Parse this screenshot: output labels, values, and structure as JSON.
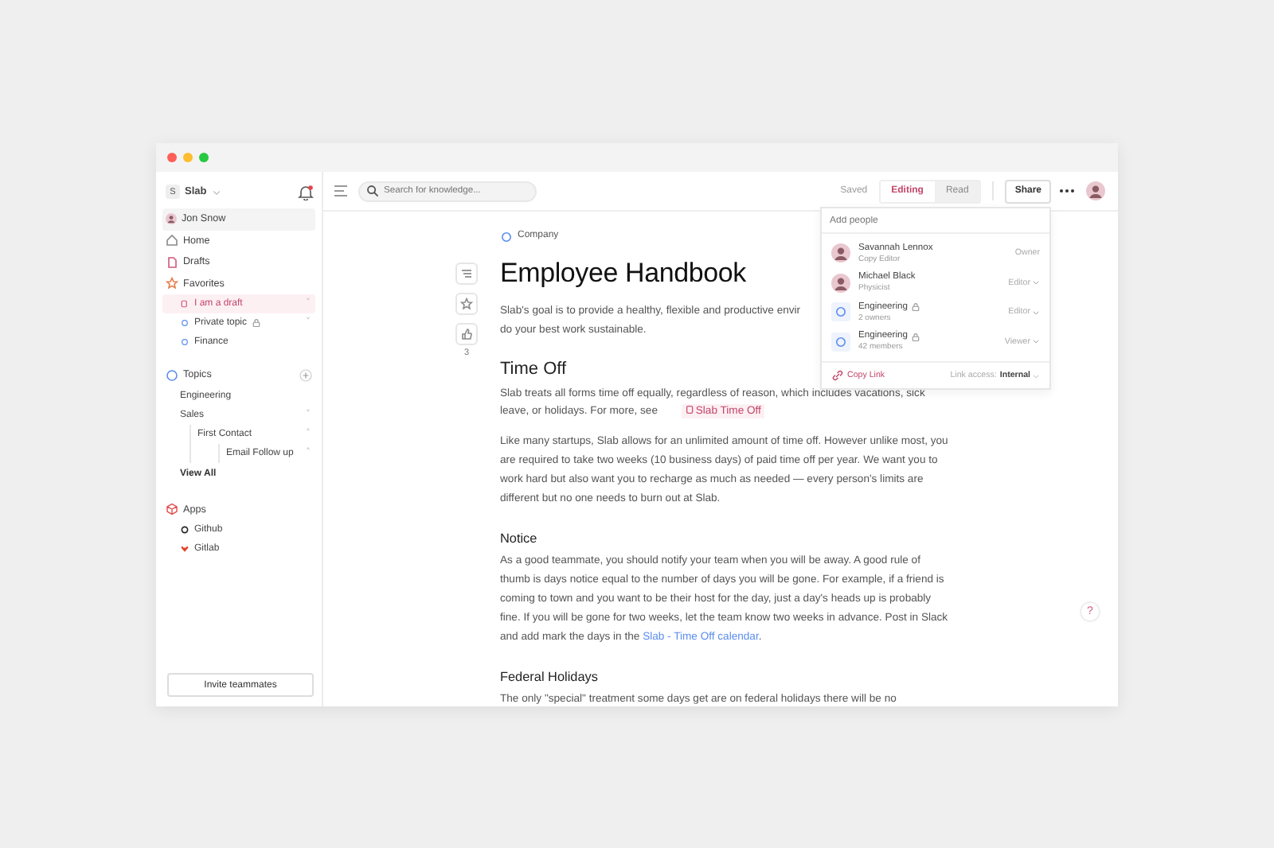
{
  "sidebar": {
    "workspace": {
      "initial": "S",
      "name": "Slab"
    },
    "user": "Jon Snow",
    "nav": [
      {
        "label": "Home",
        "kind": "home"
      },
      {
        "label": "Drafts",
        "kind": "drafts"
      },
      {
        "label": "Favorites",
        "kind": "favorites"
      }
    ],
    "favorites": [
      {
        "label": "I am a draft",
        "kind": "draft",
        "selected": true,
        "locked": false,
        "chevron": "˅"
      },
      {
        "label": "Private topic",
        "kind": "topic",
        "selected": false,
        "locked": true,
        "chevron": "˅"
      },
      {
        "label": "Finance",
        "kind": "topic",
        "selected": false,
        "locked": false
      }
    ],
    "topics": {
      "label": "Topics",
      "items": [
        {
          "label": "Engineering"
        },
        {
          "label": "Sales",
          "chevron": "˅",
          "children": [
            {
              "label": "First Contact",
              "chevron": "˄",
              "children": [
                {
                  "label": "Email Follow up",
                  "chevron": "˄"
                }
              ]
            }
          ]
        }
      ],
      "view_all": "View All"
    },
    "apps": {
      "label": "Apps",
      "items": [
        {
          "label": "Github",
          "kind": "github"
        },
        {
          "label": "Gitlab",
          "kind": "gitlab"
        }
      ]
    },
    "invite_button": "Invite teammates"
  },
  "toolbar": {
    "search_placeholder": "Search for knowledge...",
    "status": "Saved",
    "modes": [
      {
        "label": "Editing",
        "selected": true
      },
      {
        "label": "Read",
        "selected": false
      }
    ],
    "share": "Share"
  },
  "document": {
    "breadcrumb": "Company",
    "title": "Employee Handbook",
    "like_count": "3",
    "blocks": [
      {
        "kind": "lines",
        "lines": [
          "Slab's goal is to provide a healthy, flexible and productive envir",
          "do your best work sustainable."
        ]
      },
      {
        "kind": "heading",
        "text": "Time Off"
      },
      {
        "kind": "paragraph",
        "text": "Slab treats all forms time off equally, regardless of reason, which includes vacations, sick leave, or holidays. For more, see",
        "link": {
          "text": "Slab Time Off",
          "kind": "doc"
        }
      },
      {
        "kind": "paragraph",
        "text": "Like many startups, Slab allows for an unlimited amount of time off. However unlike most, you are required to take two weeks (10 business days) of paid time off per year. We want you to work hard but also want you to recharge as much as needed — every person's limits are different but no one needs to burn out at Slab."
      },
      {
        "kind": "subheading",
        "text": "Notice"
      },
      {
        "kind": "paragraph",
        "text": "As a good teammate, you should notify your team when you will be away. A good rule of thumb is days notice equal to the number of days you will be gone. For example, if a friend is coming to town and you want to be their host for the day, just a day's heads up is probably fine. If you will be gone for two weeks, let the team know two weeks in advance. Post in Slack and add mark the days in the",
        "link": {
          "text": "Slab - Time Off calendar",
          "kind": "plain"
        },
        "after": "."
      },
      {
        "kind": "subheading",
        "text": "Federal Holidays"
      },
      {
        "kind": "paragraph",
        "text": "The only \"special\" treatment some days get are on federal holidays there will be no"
      }
    ]
  },
  "share_popup": {
    "placeholder": "Add people",
    "people": [
      {
        "kind": "person",
        "name": "Savannah Lennox",
        "role": "Copy Editor",
        "access": "Owner",
        "locked": false,
        "menu": false
      },
      {
        "kind": "person",
        "name": "Michael Black",
        "role": "Physicist",
        "access": "Editor",
        "locked": false,
        "menu": true
      },
      {
        "kind": "group",
        "name": "Engineering",
        "role": "2 owners",
        "access": "Editor",
        "locked": true,
        "menu": true
      },
      {
        "kind": "group",
        "name": "Engineering",
        "role": "42 members",
        "access": "Viewer",
        "locked": true,
        "menu": true
      }
    ],
    "copy_link": "Copy Link",
    "link_access_label": "Link access:",
    "link_access_value": "Internal"
  },
  "help": "?"
}
